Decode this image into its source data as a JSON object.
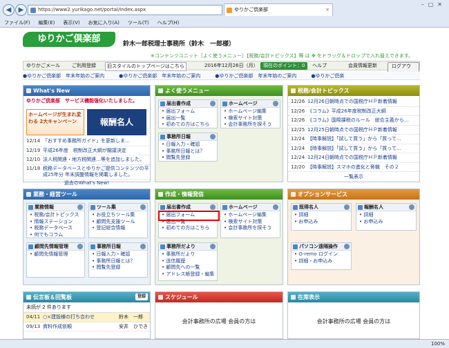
{
  "browser": {
    "url": "https://www2.yurikago.net/portal/Index.aspx",
    "tab_title": "ゆりかご倶楽部",
    "menu": [
      "ファイル(F)",
      "編集(E)",
      "表示(V)",
      "お気に入り(A)",
      "ツール(T)",
      "ヘルプ(H)"
    ],
    "zoom": "100%"
  },
  "header": {
    "logo": "ゆりかご倶楽部",
    "office": "鈴木一郎税理士事務所（鈴木　一郎様）",
    "notice": "※コンテンツユニット［よく使うメニュー］【税務/会計トピックス】等 は ✥ をドラッグ＆ドロップで入れ替えできます。",
    "mail": "ゆりかごメール",
    "register": "ご利用登録",
    "old_style": "旧スタイルのトップページはこちら",
    "date": "2016年12月26日（月）",
    "points_label": "現在のポイント：",
    "points": "0",
    "help": "ヘルプ",
    "member_update": "会員情報更新",
    "logout": "ログアウト"
  },
  "ticker": "●ゆりかご倶楽部　年末年始のご案内　　　●ゆりかご倶楽部　年末年始のご案内　　　●ゆりかご倶楽部　年末年始のご案内　　　●ゆりかご倶楽",
  "whats_new": {
    "title": "What's New",
    "intro": "ゆりかご倶楽部　サービス機能強化いたしました。",
    "banner1": "ホームページが生まれ変わる 2大キャンペーン",
    "banner2": "報酬名人",
    "items": [
      {
        "date": "12/14",
        "text": "「おすすめ事務所ガイド」を更新しま…"
      },
      {
        "date": "12/19",
        "text": "平成26年度　税制改正大綱が閣議決定"
      },
      {
        "date": "12/10",
        "text": "法人税関連・地方税関連…等を追加しました。"
      },
      {
        "date": "11/18",
        "text": "税務データベースとゆりかご提供コンテンツの平成25年分 年末調整情報を掲載しました。"
      }
    ],
    "more": "過去のWhat's New!"
  },
  "favorites": {
    "title": "よく使うメニュー",
    "boxes": [
      {
        "title": "届出書作成",
        "items": [
          "届出フォーム",
          "届出一覧",
          "初めての方はこちら"
        ]
      },
      {
        "title": "ホームページ",
        "items": [
          "ホームページ編集",
          "検索サイト対策",
          "会計事務所を探そう"
        ]
      },
      {
        "title": "事務所日報",
        "items": [
          "日報入力・確認",
          "事務所日報とは？",
          "閲覧先登録"
        ]
      }
    ]
  },
  "topics": {
    "title": "税務/会計トピックス",
    "items": [
      {
        "date": "12/26",
        "text": "12月26日朝時点での国税庁ＨＰ新着情報"
      },
      {
        "date": "12/26",
        "text": "《コラム》平成26年度税制改正大綱"
      },
      {
        "date": "12/26",
        "text": "《コラム》国際課税のルール　総合主義から…"
      },
      {
        "date": "12/25",
        "text": "12月25日朝時点での国税庁ＨＰ新着情報"
      },
      {
        "date": "12/24",
        "text": "【時事解説】「試して買う」から「買って…"
      },
      {
        "date": "12/24",
        "text": "【時事解説】「試して買う」から「買って…"
      },
      {
        "date": "12/24",
        "text": "12月24日朝時点での国税庁ＨＰ新着情報"
      },
      {
        "date": "12/20",
        "text": "【時事解説】スマホの進化と脅機　その２"
      }
    ],
    "more": "一覧表示"
  },
  "business": {
    "title": "業務・経営ツール",
    "boxes": [
      {
        "title": "業務情報",
        "items": [
          "税務/会計トピックス",
          "情報ステーション",
          "税務データベース",
          "何でもコラム"
        ]
      },
      {
        "title": "ツール集",
        "items": [
          "お役立ちツール集",
          "顧問先支援ツール",
          "登記総合情報"
        ]
      },
      {
        "title": "顧問先情報管理",
        "items": [
          "顧問先情報管理"
        ]
      },
      {
        "title": "事務所日報",
        "items": [
          "日報入力・確認",
          "事務所日報とは？",
          "閲覧先登録"
        ]
      }
    ]
  },
  "creation": {
    "title": "作成・情報発信",
    "boxes": [
      {
        "title": "届出書作成",
        "items": [
          "届出フォーム",
          "届出一覧",
          "初めての方はこちら"
        ]
      },
      {
        "title": "ホームページ",
        "items": [
          "ホームページ編集",
          "検索サイト対策",
          "会計事務所を探そう"
        ]
      },
      {
        "title": "事務所だより",
        "items": [
          "事務所だより",
          "送信履歴",
          "顧問先への一覧",
          "アドレス帳登録・編集"
        ]
      }
    ]
  },
  "options": {
    "title": "オプションサービス",
    "boxes": [
      {
        "title": "既得名人",
        "items": [
          "詳細",
          "お申込み"
        ]
      },
      {
        "title": "報酬名人",
        "items": [
          "詳細",
          "お申込み"
        ]
      },
      {
        "title": "パソコン遠隔操作",
        "items": [
          "O-remo ログイン",
          "詳細・お申込み"
        ]
      }
    ]
  },
  "messages": {
    "title": "伝言板＆回覧板",
    "register": "登録",
    "unread": "未読が 2 件あります",
    "items": [
      {
        "date": "04/11",
        "text": "○×建設様の打ち合わせ",
        "name": "鈴木　一郎"
      },
      {
        "date": "09/13",
        "text": "資料作成依頼",
        "name": "安井　ひでき"
      }
    ]
  },
  "schedule": {
    "title": "スケジュール",
    "text": "会計事務所の広場 会員の方は"
  },
  "library": {
    "title": "在席表示",
    "text": "会計事務所の広場 会員の方は"
  }
}
